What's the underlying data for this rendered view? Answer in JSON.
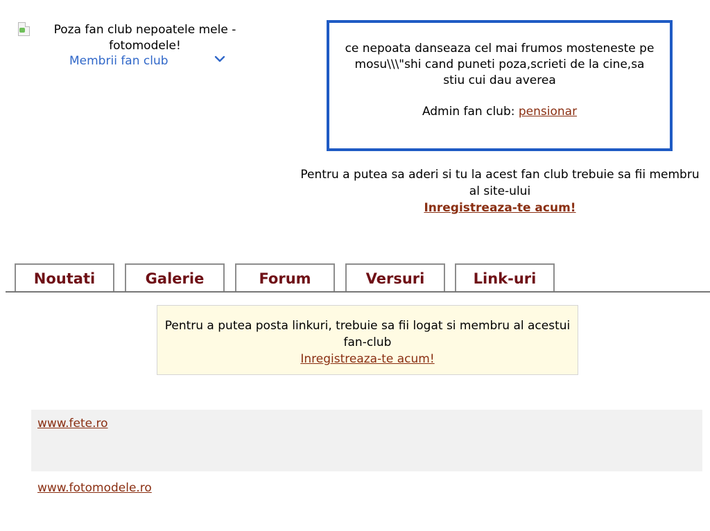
{
  "club": {
    "image_alt_icon": "broken-image-icon",
    "title": "Poza fan club nepoatele mele - fotomodele!",
    "members_link": "Membrii fan club",
    "members_icon": "chevron-down-icon"
  },
  "description": {
    "text": "ce nepoata danseaza cel mai frumos mosteneste pe mosu\\\\\\\"shi cand puneti poza,scrieti de la cine,sa stiu cui dau averea",
    "admin_label": "Admin fan club:",
    "admin_name": "pensionar"
  },
  "join": {
    "text": "Pentru a putea sa aderi si tu la acest fan club trebuie sa fii membru al site-ului",
    "register_link": "Inregistreaza-te acum!"
  },
  "tabs": [
    {
      "label": "Noutati"
    },
    {
      "label": "Galerie"
    },
    {
      "label": "Forum"
    },
    {
      "label": "Versuri"
    },
    {
      "label": "Link-uri"
    }
  ],
  "notice": {
    "text": "Pentru a putea posta linkuri, trebuie sa fii logat si membru al acestui fan-club",
    "register_link": "Inregistreaza-te acum!"
  },
  "links": [
    {
      "url": "www.fete.ro"
    },
    {
      "url": "www.fotomodele.ro"
    }
  ],
  "colors": {
    "box_border": "#1f5bc4",
    "link": "#8a2f12",
    "tab_text": "#6f1016",
    "notice_bg": "#fffbe3",
    "member_link": "#3168c9"
  }
}
